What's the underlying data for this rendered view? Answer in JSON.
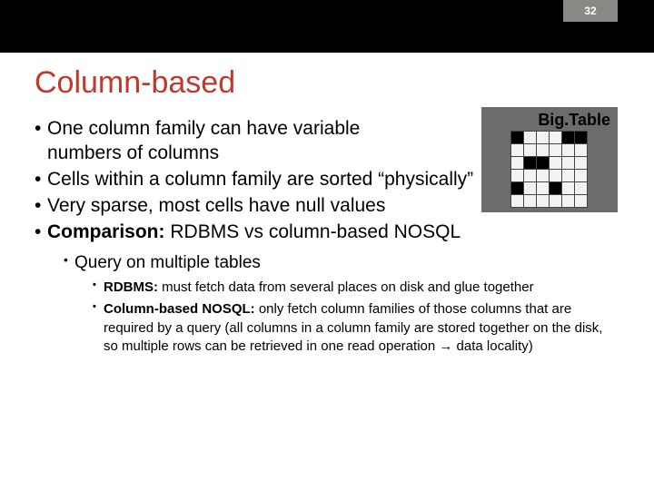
{
  "slide_number": "32",
  "title": "Column-based",
  "illustration": {
    "label": "Big.Table"
  },
  "bullets": [
    {
      "line1": "One column family can have variable",
      "line2": "numbers of columns"
    },
    {
      "text": "Cells within a column family are sorted “physically”"
    },
    {
      "text": "Very sparse, most cells have null values"
    },
    {
      "bold": "Comparison:",
      "rest": " RDBMS vs column-based NOSQL",
      "sub": [
        {
          "text": "Query on multiple tables",
          "sub": [
            {
              "bold": "RDBMS: ",
              "rest": "must fetch data from several places on disk and glue together"
            },
            {
              "bold": "Column-based NOSQL: ",
              "rest": "only fetch column families of those columns that are required by a query (all columns in a column family are stored together on the disk, so multiple rows can be retrieved in one read operation → data locality)"
            }
          ]
        }
      ]
    }
  ]
}
